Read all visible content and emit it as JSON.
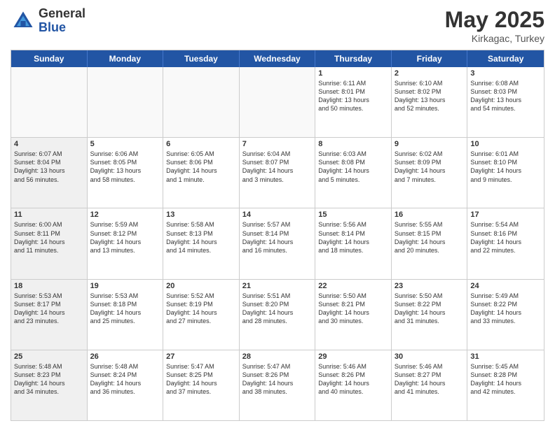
{
  "logo": {
    "general": "General",
    "blue": "Blue"
  },
  "title": {
    "month": "May 2025",
    "location": "Kirkagac, Turkey"
  },
  "header_days": [
    "Sunday",
    "Monday",
    "Tuesday",
    "Wednesday",
    "Thursday",
    "Friday",
    "Saturday"
  ],
  "weeks": [
    [
      {
        "day": "",
        "info": "",
        "shaded": true
      },
      {
        "day": "",
        "info": "",
        "shaded": true
      },
      {
        "day": "",
        "info": "",
        "shaded": true
      },
      {
        "day": "",
        "info": "",
        "shaded": true
      },
      {
        "day": "1",
        "info": "Sunrise: 6:11 AM\nSunset: 8:01 PM\nDaylight: 13 hours\nand 50 minutes.",
        "shaded": false
      },
      {
        "day": "2",
        "info": "Sunrise: 6:10 AM\nSunset: 8:02 PM\nDaylight: 13 hours\nand 52 minutes.",
        "shaded": false
      },
      {
        "day": "3",
        "info": "Sunrise: 6:08 AM\nSunset: 8:03 PM\nDaylight: 13 hours\nand 54 minutes.",
        "shaded": false
      }
    ],
    [
      {
        "day": "4",
        "info": "Sunrise: 6:07 AM\nSunset: 8:04 PM\nDaylight: 13 hours\nand 56 minutes.",
        "shaded": true
      },
      {
        "day": "5",
        "info": "Sunrise: 6:06 AM\nSunset: 8:05 PM\nDaylight: 13 hours\nand 58 minutes.",
        "shaded": false
      },
      {
        "day": "6",
        "info": "Sunrise: 6:05 AM\nSunset: 8:06 PM\nDaylight: 14 hours\nand 1 minute.",
        "shaded": false
      },
      {
        "day": "7",
        "info": "Sunrise: 6:04 AM\nSunset: 8:07 PM\nDaylight: 14 hours\nand 3 minutes.",
        "shaded": false
      },
      {
        "day": "8",
        "info": "Sunrise: 6:03 AM\nSunset: 8:08 PM\nDaylight: 14 hours\nand 5 minutes.",
        "shaded": false
      },
      {
        "day": "9",
        "info": "Sunrise: 6:02 AM\nSunset: 8:09 PM\nDaylight: 14 hours\nand 7 minutes.",
        "shaded": false
      },
      {
        "day": "10",
        "info": "Sunrise: 6:01 AM\nSunset: 8:10 PM\nDaylight: 14 hours\nand 9 minutes.",
        "shaded": false
      }
    ],
    [
      {
        "day": "11",
        "info": "Sunrise: 6:00 AM\nSunset: 8:11 PM\nDaylight: 14 hours\nand 11 minutes.",
        "shaded": true
      },
      {
        "day": "12",
        "info": "Sunrise: 5:59 AM\nSunset: 8:12 PM\nDaylight: 14 hours\nand 13 minutes.",
        "shaded": false
      },
      {
        "day": "13",
        "info": "Sunrise: 5:58 AM\nSunset: 8:13 PM\nDaylight: 14 hours\nand 14 minutes.",
        "shaded": false
      },
      {
        "day": "14",
        "info": "Sunrise: 5:57 AM\nSunset: 8:14 PM\nDaylight: 14 hours\nand 16 minutes.",
        "shaded": false
      },
      {
        "day": "15",
        "info": "Sunrise: 5:56 AM\nSunset: 8:14 PM\nDaylight: 14 hours\nand 18 minutes.",
        "shaded": false
      },
      {
        "day": "16",
        "info": "Sunrise: 5:55 AM\nSunset: 8:15 PM\nDaylight: 14 hours\nand 20 minutes.",
        "shaded": false
      },
      {
        "day": "17",
        "info": "Sunrise: 5:54 AM\nSunset: 8:16 PM\nDaylight: 14 hours\nand 22 minutes.",
        "shaded": false
      }
    ],
    [
      {
        "day": "18",
        "info": "Sunrise: 5:53 AM\nSunset: 8:17 PM\nDaylight: 14 hours\nand 23 minutes.",
        "shaded": true
      },
      {
        "day": "19",
        "info": "Sunrise: 5:53 AM\nSunset: 8:18 PM\nDaylight: 14 hours\nand 25 minutes.",
        "shaded": false
      },
      {
        "day": "20",
        "info": "Sunrise: 5:52 AM\nSunset: 8:19 PM\nDaylight: 14 hours\nand 27 minutes.",
        "shaded": false
      },
      {
        "day": "21",
        "info": "Sunrise: 5:51 AM\nSunset: 8:20 PM\nDaylight: 14 hours\nand 28 minutes.",
        "shaded": false
      },
      {
        "day": "22",
        "info": "Sunrise: 5:50 AM\nSunset: 8:21 PM\nDaylight: 14 hours\nand 30 minutes.",
        "shaded": false
      },
      {
        "day": "23",
        "info": "Sunrise: 5:50 AM\nSunset: 8:22 PM\nDaylight: 14 hours\nand 31 minutes.",
        "shaded": false
      },
      {
        "day": "24",
        "info": "Sunrise: 5:49 AM\nSunset: 8:22 PM\nDaylight: 14 hours\nand 33 minutes.",
        "shaded": false
      }
    ],
    [
      {
        "day": "25",
        "info": "Sunrise: 5:48 AM\nSunset: 8:23 PM\nDaylight: 14 hours\nand 34 minutes.",
        "shaded": true
      },
      {
        "day": "26",
        "info": "Sunrise: 5:48 AM\nSunset: 8:24 PM\nDaylight: 14 hours\nand 36 minutes.",
        "shaded": false
      },
      {
        "day": "27",
        "info": "Sunrise: 5:47 AM\nSunset: 8:25 PM\nDaylight: 14 hours\nand 37 minutes.",
        "shaded": false
      },
      {
        "day": "28",
        "info": "Sunrise: 5:47 AM\nSunset: 8:26 PM\nDaylight: 14 hours\nand 38 minutes.",
        "shaded": false
      },
      {
        "day": "29",
        "info": "Sunrise: 5:46 AM\nSunset: 8:26 PM\nDaylight: 14 hours\nand 40 minutes.",
        "shaded": false
      },
      {
        "day": "30",
        "info": "Sunrise: 5:46 AM\nSunset: 8:27 PM\nDaylight: 14 hours\nand 41 minutes.",
        "shaded": false
      },
      {
        "day": "31",
        "info": "Sunrise: 5:45 AM\nSunset: 8:28 PM\nDaylight: 14 hours\nand 42 minutes.",
        "shaded": false
      }
    ]
  ]
}
